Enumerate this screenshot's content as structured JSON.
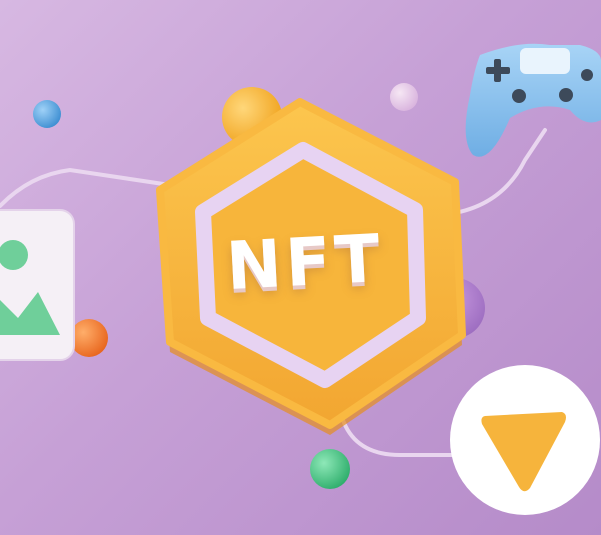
{
  "scene": {
    "badge_text": "NFT",
    "colors": {
      "background": "#c6a0d6",
      "badge_orange": "#f6b43c",
      "badge_ring": "#e7d3f2",
      "controller_blue": "#8fc2ee",
      "image_card_green": "#6fcf9a",
      "play_triangle": "#f6b43c"
    },
    "icons": [
      "nft-badge-icon",
      "game-controller-icon",
      "image-card-icon",
      "play-button-icon"
    ]
  }
}
